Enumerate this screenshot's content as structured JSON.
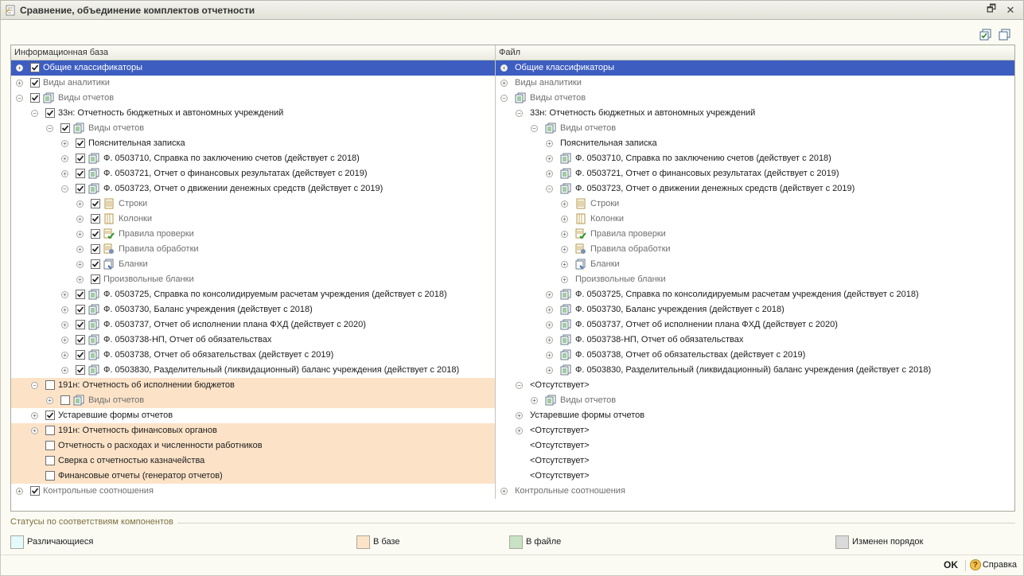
{
  "window": {
    "title": "Сравнение, объединение комплектов отчетности",
    "restore_glyph": "🗗",
    "close_glyph": "✕"
  },
  "columns": {
    "left": "Информационная база",
    "right": "Файл"
  },
  "rows": [
    {
      "l": {
        "d": 0,
        "exp": "+",
        "cb": "c",
        "icon": null,
        "t": "Общие классификаторы",
        "g": false
      },
      "r": {
        "d": 0,
        "exp": "+",
        "icon": null,
        "t": "Общие классификаторы",
        "g": false
      },
      "sel": true,
      "hl": false
    },
    {
      "l": {
        "d": 0,
        "exp": "+",
        "cb": "c",
        "icon": null,
        "t": "Виды аналитики",
        "g": true
      },
      "r": {
        "d": 0,
        "exp": "+",
        "icon": null,
        "t": "Виды аналитики",
        "g": true
      },
      "sel": false,
      "hl": false
    },
    {
      "l": {
        "d": 0,
        "exp": "-",
        "cb": "c",
        "icon": "forms",
        "t": "Виды отчетов",
        "g": true
      },
      "r": {
        "d": 0,
        "exp": "-",
        "icon": "forms",
        "t": "Виды отчетов",
        "g": true
      },
      "sel": false,
      "hl": false
    },
    {
      "l": {
        "d": 1,
        "exp": "-",
        "cb": "c",
        "icon": null,
        "t": "33н: Отчетность бюджетных и автономных учреждений",
        "g": false
      },
      "r": {
        "d": 1,
        "exp": "-",
        "icon": null,
        "t": "33н: Отчетность бюджетных и автономных учреждений",
        "g": false
      },
      "sel": false,
      "hl": false
    },
    {
      "l": {
        "d": 2,
        "exp": "-",
        "cb": "c",
        "icon": "forms",
        "t": "Виды отчетов",
        "g": true
      },
      "r": {
        "d": 2,
        "exp": "-",
        "icon": "forms",
        "t": "Виды отчетов",
        "g": true
      },
      "sel": false,
      "hl": false
    },
    {
      "l": {
        "d": 3,
        "exp": "+",
        "cb": "c",
        "icon": null,
        "t": "Пояснительная записка",
        "g": false
      },
      "r": {
        "d": 3,
        "exp": "+",
        "icon": null,
        "t": "Пояснительная записка",
        "g": false
      },
      "sel": false,
      "hl": false
    },
    {
      "l": {
        "d": 3,
        "exp": "+",
        "cb": "c",
        "icon": "forms",
        "t": "Ф. 0503710, Справка по заключению счетов (действует с 2018)",
        "g": false
      },
      "r": {
        "d": 3,
        "exp": "+",
        "icon": "forms",
        "t": "Ф. 0503710, Справка по заключению счетов (действует с 2018)",
        "g": false
      },
      "sel": false,
      "hl": false
    },
    {
      "l": {
        "d": 3,
        "exp": "+",
        "cb": "c",
        "icon": "forms",
        "t": "Ф. 0503721, Отчет о финансовых результатах (действует с 2019)",
        "g": false
      },
      "r": {
        "d": 3,
        "exp": "+",
        "icon": "forms",
        "t": "Ф. 0503721, Отчет о финансовых результатах (действует с 2019)",
        "g": false
      },
      "sel": false,
      "hl": false
    },
    {
      "l": {
        "d": 3,
        "exp": "-",
        "cb": "c",
        "icon": "forms",
        "t": "Ф. 0503723, Отчет о движении денежных средств (действует с 2019)",
        "g": false
      },
      "r": {
        "d": 3,
        "exp": "-",
        "icon": "forms",
        "t": "Ф. 0503723, Отчет о движении денежных средств (действует с 2019)",
        "g": false
      },
      "sel": false,
      "hl": false
    },
    {
      "l": {
        "d": 4,
        "exp": "+",
        "cb": "c",
        "icon": "rows",
        "t": "Строки",
        "g": true
      },
      "r": {
        "d": 4,
        "exp": "+",
        "icon": "rows",
        "t": "Строки",
        "g": true
      },
      "sel": false,
      "hl": false
    },
    {
      "l": {
        "d": 4,
        "exp": "+",
        "cb": "c",
        "icon": "cols",
        "t": "Колонки",
        "g": true
      },
      "r": {
        "d": 4,
        "exp": "+",
        "icon": "cols",
        "t": "Колонки",
        "g": true
      },
      "sel": false,
      "hl": false
    },
    {
      "l": {
        "d": 4,
        "exp": "+",
        "cb": "c",
        "icon": "check",
        "t": "Правила проверки",
        "g": true
      },
      "r": {
        "d": 4,
        "exp": "+",
        "icon": "check",
        "t": "Правила проверки",
        "g": true
      },
      "sel": false,
      "hl": false
    },
    {
      "l": {
        "d": 4,
        "exp": "+",
        "cb": "c",
        "icon": "proc",
        "t": "Правила обработки",
        "g": true
      },
      "r": {
        "d": 4,
        "exp": "+",
        "icon": "proc",
        "t": "Правила обработки",
        "g": true
      },
      "sel": false,
      "hl": false
    },
    {
      "l": {
        "d": 4,
        "exp": "+",
        "cb": "c",
        "icon": "blanks",
        "t": "Бланки",
        "g": true
      },
      "r": {
        "d": 4,
        "exp": "+",
        "icon": "blanks",
        "t": "Бланки",
        "g": true
      },
      "sel": false,
      "hl": false
    },
    {
      "l": {
        "d": 4,
        "exp": "+",
        "cb": "c",
        "icon": null,
        "t": "Произвольные бланки",
        "g": true
      },
      "r": {
        "d": 4,
        "exp": "+",
        "icon": null,
        "t": "Произвольные бланки",
        "g": true
      },
      "sel": false,
      "hl": false
    },
    {
      "l": {
        "d": 3,
        "exp": "+",
        "cb": "c",
        "icon": "forms",
        "t": "Ф. 0503725, Справка по консолидируемым расчетам учреждения (действует с 2018)",
        "g": false
      },
      "r": {
        "d": 3,
        "exp": "+",
        "icon": "forms",
        "t": "Ф. 0503725, Справка по консолидируемым расчетам учреждения (действует с 2018)",
        "g": false
      },
      "sel": false,
      "hl": false
    },
    {
      "l": {
        "d": 3,
        "exp": "+",
        "cb": "c",
        "icon": "forms",
        "t": "Ф. 0503730, Баланс учреждения (действует с 2018)",
        "g": false
      },
      "r": {
        "d": 3,
        "exp": "+",
        "icon": "forms",
        "t": "Ф. 0503730, Баланс учреждения (действует с 2018)",
        "g": false
      },
      "sel": false,
      "hl": false
    },
    {
      "l": {
        "d": 3,
        "exp": "+",
        "cb": "c",
        "icon": "forms",
        "t": "Ф. 0503737, Отчет об исполнении плана ФХД (действует с 2020)",
        "g": false
      },
      "r": {
        "d": 3,
        "exp": "+",
        "icon": "forms",
        "t": "Ф. 0503737, Отчет об исполнении плана ФХД (действует с 2020)",
        "g": false
      },
      "sel": false,
      "hl": false
    },
    {
      "l": {
        "d": 3,
        "exp": "+",
        "cb": "c",
        "icon": "forms",
        "t": "Ф. 0503738-НП, Отчет об обязательствах",
        "g": false
      },
      "r": {
        "d": 3,
        "exp": "+",
        "icon": "forms",
        "t": "Ф. 0503738-НП, Отчет об обязательствах",
        "g": false
      },
      "sel": false,
      "hl": false
    },
    {
      "l": {
        "d": 3,
        "exp": "+",
        "cb": "c",
        "icon": "forms",
        "t": "Ф. 0503738, Отчет об обязательствах (действует с 2019)",
        "g": false
      },
      "r": {
        "d": 3,
        "exp": "+",
        "icon": "forms",
        "t": "Ф. 0503738, Отчет об обязательствах (действует с 2019)",
        "g": false
      },
      "sel": false,
      "hl": false
    },
    {
      "l": {
        "d": 3,
        "exp": "+",
        "cb": "c",
        "icon": "forms",
        "t": "Ф. 0503830, Разделительный (ликвидационный) баланс учреждения (действует с 2018)",
        "g": false
      },
      "r": {
        "d": 3,
        "exp": "+",
        "icon": "forms",
        "t": "Ф. 0503830, Разделительный (ликвидационный) баланс учреждения (действует с 2018)",
        "g": false
      },
      "sel": false,
      "hl": false
    },
    {
      "l": {
        "d": 1,
        "exp": "-",
        "cb": "u",
        "icon": null,
        "t": "191н: Отчетность об исполнении бюджетов",
        "g": false
      },
      "r": {
        "d": 1,
        "exp": "-",
        "icon": null,
        "t": "<Отсутствует>",
        "g": false
      },
      "sel": false,
      "hl": true
    },
    {
      "l": {
        "d": 2,
        "exp": "+",
        "cb": "u",
        "icon": "forms",
        "t": "Виды отчетов",
        "g": true
      },
      "r": {
        "d": 2,
        "exp": "+",
        "icon": "forms",
        "t": "Виды отчетов",
        "g": true
      },
      "sel": false,
      "hl": true
    },
    {
      "l": {
        "d": 1,
        "exp": "+",
        "cb": "c",
        "icon": null,
        "t": "Устаревшие формы отчетов",
        "g": false
      },
      "r": {
        "d": 1,
        "exp": "+",
        "icon": null,
        "t": "Устаревшие формы отчетов",
        "g": false
      },
      "sel": false,
      "hl": false
    },
    {
      "l": {
        "d": 1,
        "exp": "+",
        "cb": "u",
        "icon": null,
        "t": "191н: Отчетность финансовых органов",
        "g": false
      },
      "r": {
        "d": 1,
        "exp": "+",
        "icon": null,
        "t": "<Отсутствует>",
        "g": false
      },
      "sel": false,
      "hl": true
    },
    {
      "l": {
        "d": 1,
        "exp": null,
        "cb": "u",
        "icon": null,
        "t": "Отчетность о расходах и численности работников",
        "g": false
      },
      "r": {
        "d": 1,
        "exp": null,
        "icon": null,
        "t": "<Отсутствует>",
        "g": false
      },
      "sel": false,
      "hl": true
    },
    {
      "l": {
        "d": 1,
        "exp": null,
        "cb": "u",
        "icon": null,
        "t": "Сверка с отчетностью казначейства",
        "g": false
      },
      "r": {
        "d": 1,
        "exp": null,
        "icon": null,
        "t": "<Отсутствует>",
        "g": false
      },
      "sel": false,
      "hl": true
    },
    {
      "l": {
        "d": 1,
        "exp": null,
        "cb": "u",
        "icon": null,
        "t": "Финансовые отчеты (генератор отчетов)",
        "g": false
      },
      "r": {
        "d": 1,
        "exp": null,
        "icon": null,
        "t": "<Отсутствует>",
        "g": false
      },
      "sel": false,
      "hl": true
    },
    {
      "l": {
        "d": 0,
        "exp": "+",
        "cb": "c",
        "icon": null,
        "t": "Контрольные соотношения",
        "g": true
      },
      "r": {
        "d": 0,
        "exp": "+",
        "icon": null,
        "t": "Контрольные соотношения",
        "g": true
      },
      "sel": false,
      "hl": false
    }
  ],
  "legend": {
    "caption": "Статусы по соответствиям компонентов",
    "items": [
      {
        "label": "Различающиеся",
        "color": "#e4fbfb"
      },
      {
        "label": "В базе",
        "color": "#fce3c8"
      },
      {
        "label": "В файле",
        "color": "#c8e2c4"
      },
      {
        "label": "Изменен порядок",
        "color": "#dadada"
      }
    ]
  },
  "buttons": {
    "ok": "OK",
    "help": "Справка",
    "help_glyph": "?"
  },
  "colors": {
    "selection": "#3d5dc0",
    "in_base": "#fce3c8"
  }
}
